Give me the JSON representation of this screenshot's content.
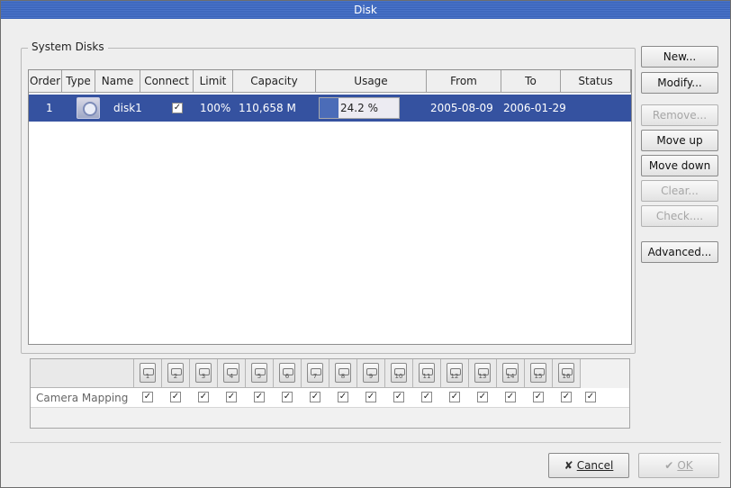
{
  "window": {
    "title": "Disk"
  },
  "system_disks": {
    "title": "System Disks",
    "columns": [
      "Order",
      "Type",
      "Name",
      "Connect",
      "Limit",
      "Capacity",
      "Usage",
      "From",
      "To",
      "Status"
    ],
    "rows": [
      {
        "order": "1",
        "type_icon": "hard-disk-icon",
        "name": "disk1",
        "connect": "✓",
        "limit": "100%",
        "capacity": "110,658 M",
        "usage": "24.2 %",
        "usage_fraction": 0.242,
        "from": "2005-08-09",
        "to": "2006-01-29",
        "status": ""
      }
    ]
  },
  "side_buttons": {
    "new": "New...",
    "modify": "Modify...",
    "remove": "Remove...",
    "move_up": "Move up",
    "move_down": "Move down",
    "clear": "Clear...",
    "check": "Check....",
    "advanced": "Advanced..."
  },
  "camera_mapping": {
    "label": "Camera Mapping",
    "check_mark": "✓",
    "cameras": [
      "1",
      "2",
      "3",
      "4",
      "5",
      "6",
      "7",
      "8",
      "9",
      "10",
      "11",
      "12",
      "13",
      "14",
      "15",
      "16"
    ]
  },
  "footer": {
    "cancel_label": "Cancel",
    "ok_label": "OK",
    "cancel_icon": "✘",
    "ok_icon": "✔"
  },
  "colors": {
    "selection": "#3552a0",
    "titlebar": "#4a74c9"
  }
}
